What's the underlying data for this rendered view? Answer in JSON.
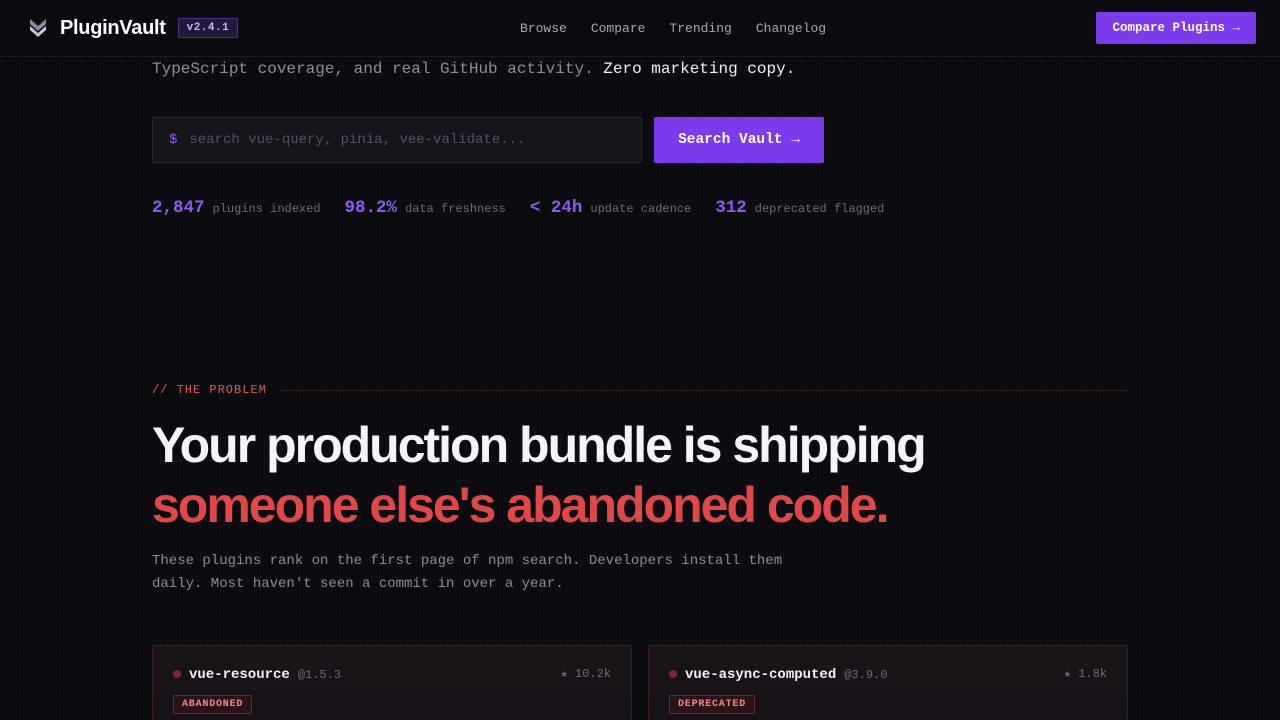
{
  "nav": {
    "brand": "PluginVault",
    "version": "v2.4.1",
    "links": [
      "Browse",
      "Compare",
      "Trending",
      "Changelog"
    ],
    "cta": "Compare Plugins →"
  },
  "hero": {
    "line_text": "TypeScript coverage, and real GitHub activity.",
    "line_strong": "Zero marketing copy.",
    "search_prompt": "$",
    "search_placeholder": "search vue-query, pinia, vee-validate...",
    "search_button": "Search Vault →",
    "stats": [
      {
        "value": "2,847",
        "label": "plugins indexed"
      },
      {
        "value": "98.2%",
        "label": "data freshness"
      },
      {
        "value": "< 24h",
        "label": "update cadence"
      },
      {
        "value": "312",
        "label": "deprecated flagged"
      }
    ]
  },
  "problem": {
    "eyebrow": "// THE PROBLEM",
    "headline_1": "Your production bundle is shipping",
    "headline_2": "someone else's abandoned code.",
    "body_1": "These plugins rank on the first page of npm search. Developers install them",
    "body_2": "daily. Most haven't seen a commit in over a year."
  },
  "cards": [
    {
      "name": "vue-resource",
      "version": "@1.5.3",
      "stars": "★ 10.2k",
      "status": "ABANDONED"
    },
    {
      "name": "vue-async-computed",
      "version": "@3.9.0",
      "stars": "★ 1.8k",
      "status": "DEPRECATED"
    }
  ],
  "colors": {
    "accent": "#7c3aed",
    "danger": "#e04848"
  }
}
